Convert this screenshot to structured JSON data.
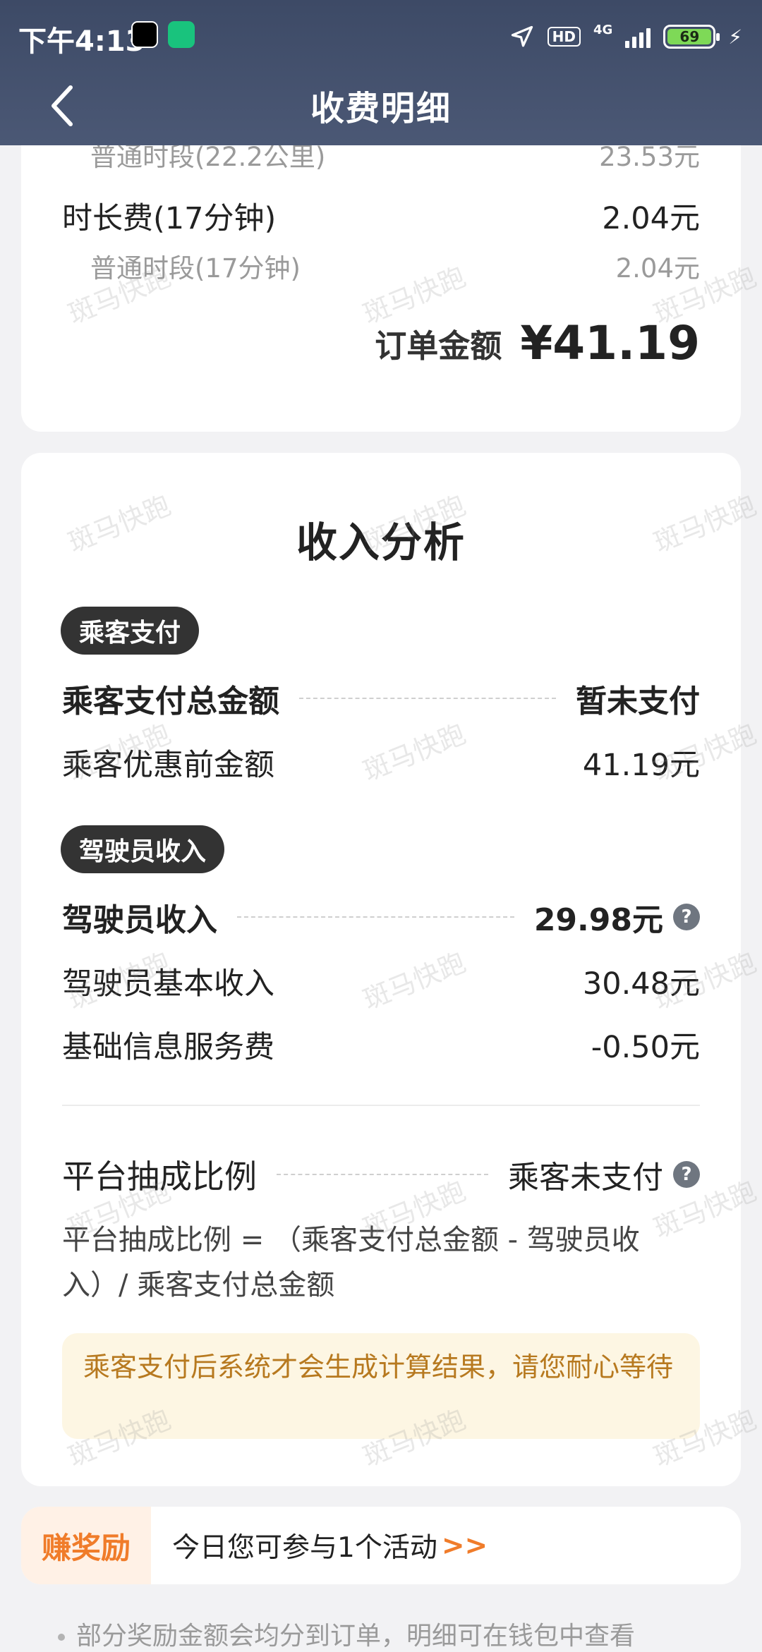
{
  "status_bar": {
    "time": "下午4:13",
    "hd": "HD",
    "network": "4G",
    "battery": "69",
    "battery_level_percent": 69
  },
  "nav": {
    "title": "收费明细"
  },
  "fee_detail": {
    "partial_row_label": "普通时段(22.2公里)",
    "partial_row_value": "23.53元",
    "duration_fee_label": "时长费(17分钟)",
    "duration_fee_value": "2.04元",
    "duration_sub_label": "普通时段(17分钟)",
    "duration_sub_value": "2.04元",
    "order_total_label": "订单金额",
    "order_total_value": "¥41.19"
  },
  "income_analysis": {
    "title": "收入分析",
    "passenger_chip": "乘客支付",
    "passenger_total_label": "乘客支付总金额",
    "passenger_total_value": "暂未支付",
    "passenger_pre_discount_label": "乘客优惠前金额",
    "passenger_pre_discount_value": "41.19元",
    "driver_chip": "驾驶员收入",
    "driver_income_label": "驾驶员收入",
    "driver_income_value": "29.98元",
    "driver_base_label": "驾驶员基本收入",
    "driver_base_value": "30.48元",
    "service_fee_label": "基础信息服务费",
    "service_fee_value": "-0.50元",
    "commission_label": "平台抽成比例",
    "commission_value": "乘客未支付",
    "formula": "平台抽成比例 = （乘客支付总金额 - 驾驶员收入）/ 乘客支付总金额",
    "notice": "乘客支付后系统才会生成计算结果，请您耐心等待"
  },
  "reward": {
    "tag": "赚奖励",
    "text": "今日您可参与1个活动",
    "arrow": ">>"
  },
  "bottom_note": "部分奖励金额会均分到订单，明细可在钱包中查看",
  "watermark": "斑马快跑",
  "colors": {
    "header_bg": "#44506c",
    "accent_orange": "#f07c2a",
    "notice_text": "#b7791f",
    "notice_bg": "#fdf6e3"
  }
}
